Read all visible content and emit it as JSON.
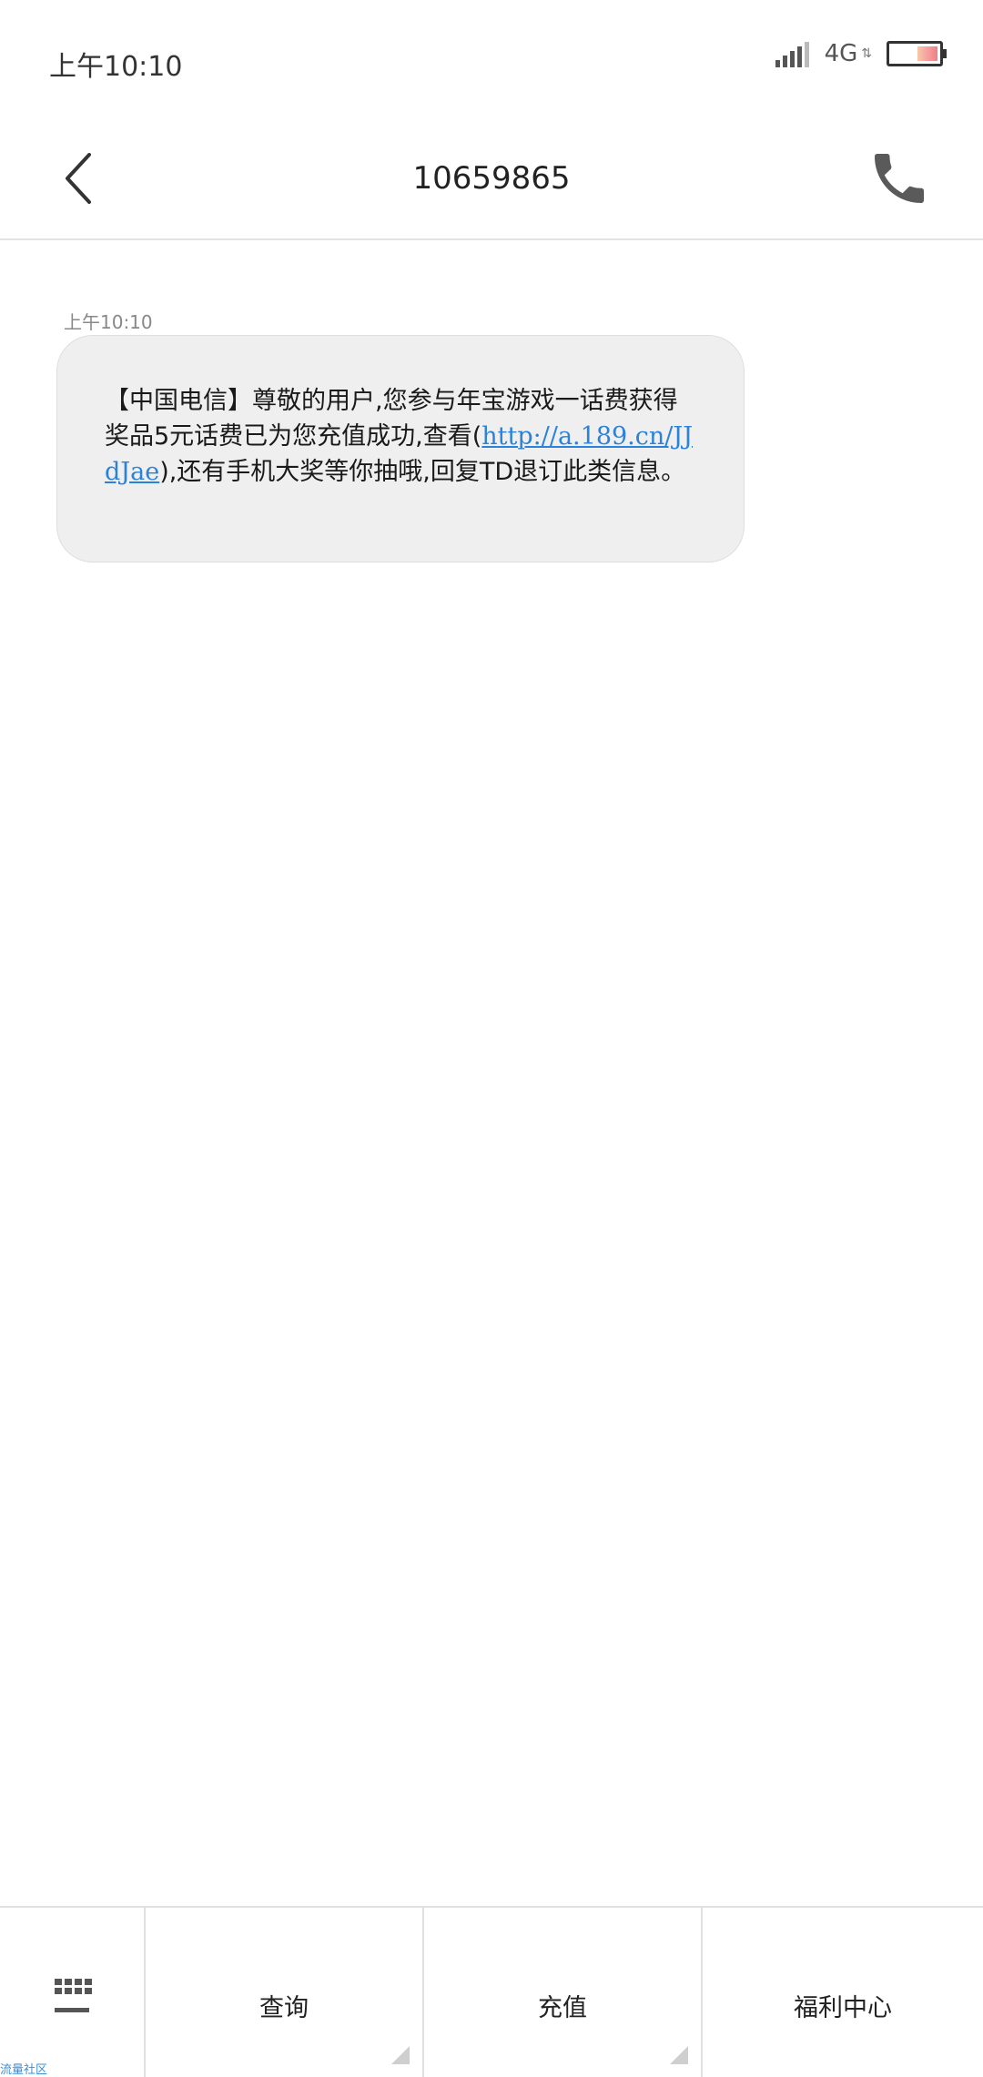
{
  "status_bar": {
    "time": "上午10:10",
    "network": "4G",
    "network_arrows": "⇅"
  },
  "header": {
    "title": "10659865"
  },
  "message": {
    "time": "上午10:10",
    "text_before": "【中国电信】尊敬的用户,您参与年宝游戏一话费获得奖品5元话费已为您充值成功,查看(",
    "link": "http://a.189.cn/JJdJae",
    "text_after": "),还有手机大奖等你抽哦,回复TD退订此类信息。",
    "link_color": "#2b82d9"
  },
  "bottom_menu": {
    "community_label": "流量社区",
    "items": [
      {
        "label": "查询",
        "has_submenu": true
      },
      {
        "label": "充值",
        "has_submenu": true
      },
      {
        "label": "福利中心",
        "has_submenu": false
      }
    ]
  }
}
